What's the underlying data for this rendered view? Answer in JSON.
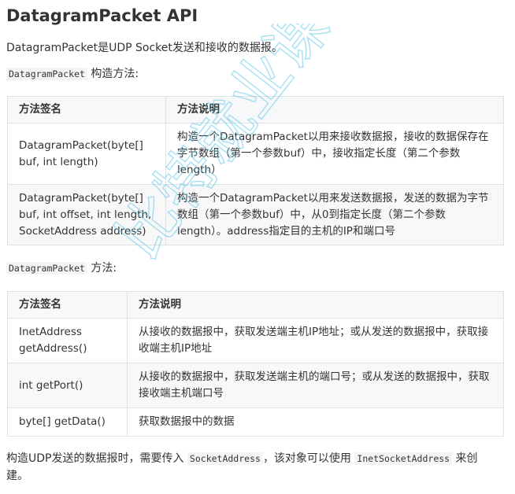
{
  "title": "DatagramPacket API",
  "intro": "DatagramPacket是UDP Socket发送和接收的数据报。",
  "ctor_section": {
    "code": "DatagramPacket",
    "text": " 构造方法:",
    "headers": [
      "方法签名",
      "方法说明"
    ],
    "rows": [
      {
        "sig": "DatagramPacket(byte[] buf, int length)",
        "desc": "构造一个DatagramPacket以用来接收数据报，接收的数据保存在字节数组（第一个参数buf）中，接收指定长度（第二个参数length）"
      },
      {
        "sig": "DatagramPacket(byte[] buf, int offset, int length, SocketAddress address)",
        "desc": "构造一个DatagramPacket以用来发送数据报，发送的数据为字节数组（第一个参数buf）中，从0到指定长度（第二个参数length）。address指定目的主机的IP和端口号"
      }
    ]
  },
  "method_section": {
    "code": "DatagramPacket",
    "text": " 方法:",
    "headers": [
      "方法签名",
      "方法说明"
    ],
    "rows": [
      {
        "sig": "InetAddress getAddress()",
        "desc": "从接收的数据报中，获取发送端主机IP地址；或从发送的数据报中，获取接收端主机IP地址"
      },
      {
        "sig": "int getPort()",
        "desc": "从接收的数据报中，获取发送端主机的端口号；或从发送的数据报中，获取接收端主机端口号"
      },
      {
        "sig": "byte[] getData()",
        "desc": "获取数据报中的数据"
      }
    ]
  },
  "footer": {
    "t1": "构造UDP发送的数据报时，需要传入 ",
    "c1": "SocketAddress",
    "t2": "，该对象可以使用 ",
    "c2": "InetSocketAddress",
    "t3": " 来创建。"
  },
  "watermark": {
    "text": "比特就业课",
    "color": "#5fc8e8"
  }
}
